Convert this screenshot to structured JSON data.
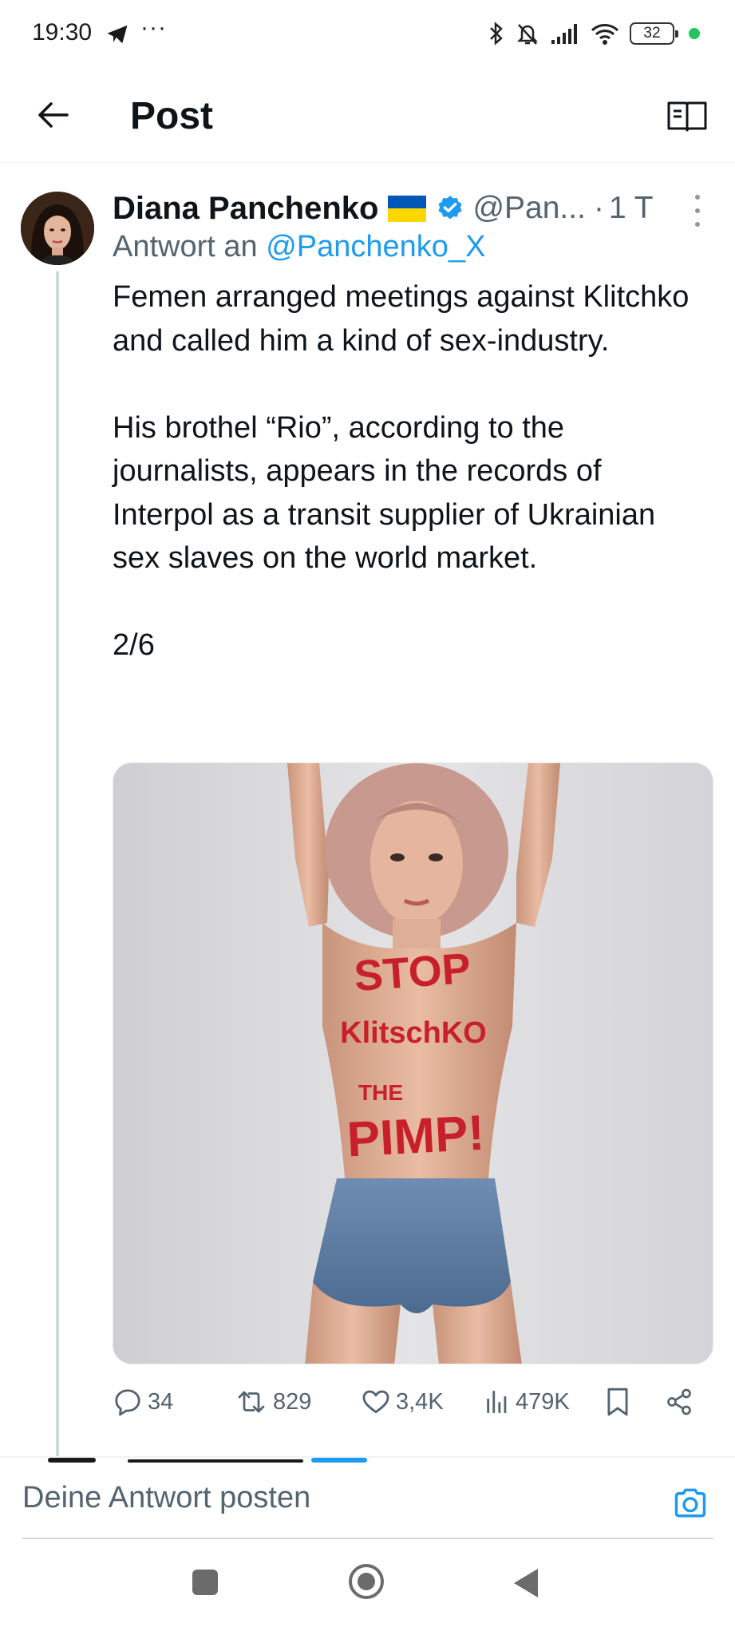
{
  "status_bar": {
    "time": "19:30",
    "overflow": "···",
    "battery": "32",
    "icons": [
      "telegram-icon",
      "bluetooth-icon",
      "mute-icon",
      "signal-icon",
      "wifi-icon",
      "battery-icon"
    ]
  },
  "header": {
    "title": "Post",
    "back_icon": "arrow-left-icon",
    "reader_icon": "book-open-icon"
  },
  "post": {
    "author_name": "Diana Panchenko",
    "handle": "@Pan...",
    "separator": "·",
    "timestamp": "1 T",
    "reply_prefix": "Antwort an",
    "reply_mention": "@Panchenko_X",
    "paragraph_1": "Femen arranged meetings against Klitchko and called him a kind of sex-industry.",
    "paragraph_2": "His brothel “Rio”, according to the journalists, appears in the records of Interpol as a transit supplier of Ukrainian sex slaves on the world market.",
    "thread_index": "2/6",
    "media_body_text": {
      "line1": "STOP",
      "line2": "KlitschKO",
      "line3": "THE",
      "line4": "PIMP!"
    },
    "actions": {
      "replies": "34",
      "reposts": "829",
      "likes": "3,4K",
      "views": "479K"
    }
  },
  "composer": {
    "placeholder": "Deine Antwort posten"
  },
  "colors": {
    "accent": "#1d9bf0",
    "secondary_text": "#536471",
    "primary_text": "#0f1419",
    "divider": "#eff3f4"
  }
}
